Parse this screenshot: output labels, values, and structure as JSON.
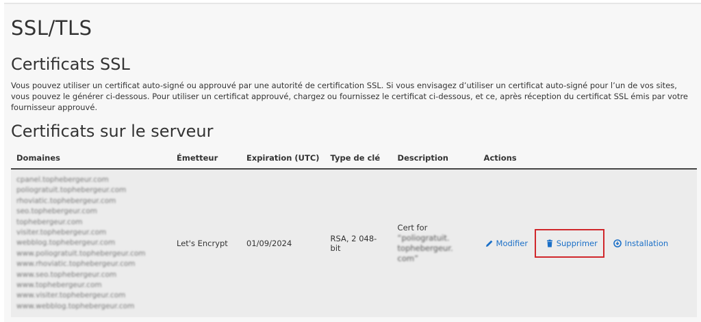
{
  "page": {
    "title": "SSL/TLS",
    "section_title": "Certificats SSL",
    "intro": "Vous pouvez utiliser un certificat auto-signé ou approuvé par une autorité de certification SSL. Si vous envisagez d’utiliser un certificat auto-signé pour l’un de vos sites, vous pouvez le générer ci-dessous. Pour utiliser un certificat approuvé, chargez ou fournissez le certificat ci-dessous, et ce, après réception du certificat SSL émis par votre fournisseur approuvé.",
    "server_title": "Certificats sur le serveur"
  },
  "table": {
    "headers": {
      "domains": "Domaines",
      "issuer": "Émetteur",
      "expiration": "Expiration (UTC)",
      "key_type": "Type de clé",
      "description": "Description",
      "actions": "Actions"
    },
    "rows": [
      {
        "domains": [
          "cpanel.tophebergeur.com",
          "poliogratuit.tophebergeur.com",
          "rhoviatic.tophebergeur.com",
          "seo.tophebergeur.com",
          "tophebergeur.com",
          "visiter.tophebergeur.com",
          "webblog.tophebergeur.com",
          "www.poliogratuit.tophebergeur.com",
          "www.rhoviatic.tophebergeur.com",
          "www.seo.tophebergeur.com",
          "www.tophebergeur.com",
          "www.visiter.tophebergeur.com",
          "www.webblog.tophebergeur.com"
        ],
        "issuer": "Let's Encrypt",
        "expiration": "01/09/2024",
        "key_type": "RSA, 2 048-bit",
        "description_prefix": "Cert for",
        "description_domain": "“poliogratuit.",
        "description_domain2": "tophebergeur.",
        "description_domain3": "com”",
        "actions": {
          "edit": "Modifier",
          "delete": "Supprimer",
          "install": "Installation"
        }
      }
    ]
  },
  "colors": {
    "link": "#1a6fc7",
    "highlight_border": "#d0262a",
    "row_bg": "#ececec"
  },
  "icons": {
    "edit": "pencil-icon",
    "delete": "trash-icon",
    "install": "circle-arrow-icon"
  }
}
